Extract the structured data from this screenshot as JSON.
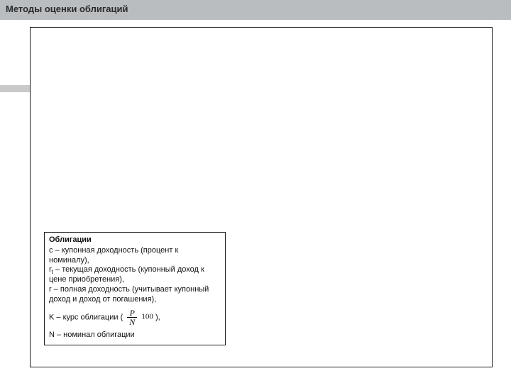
{
  "header": {
    "title": "Методы оценки облигаций"
  },
  "card": {
    "title": "Облигации",
    "line_coupon": "c – купонная доходность (процент к номиналу),",
    "line_current_prefix": "r",
    "line_current_sub": "t",
    "line_current_rest": " – текущая доходность (купонный доход к цене приобретения),",
    "line_full": "r – полная доходность (учитывает купонный доход и доход от погашения),",
    "rate_prefix": "K – курс облигации ( ",
    "rate_suffix": " ),",
    "frac_num": "P",
    "frac_den": "N",
    "times100": "100",
    "line_nominal": "N – номинал облигации"
  }
}
